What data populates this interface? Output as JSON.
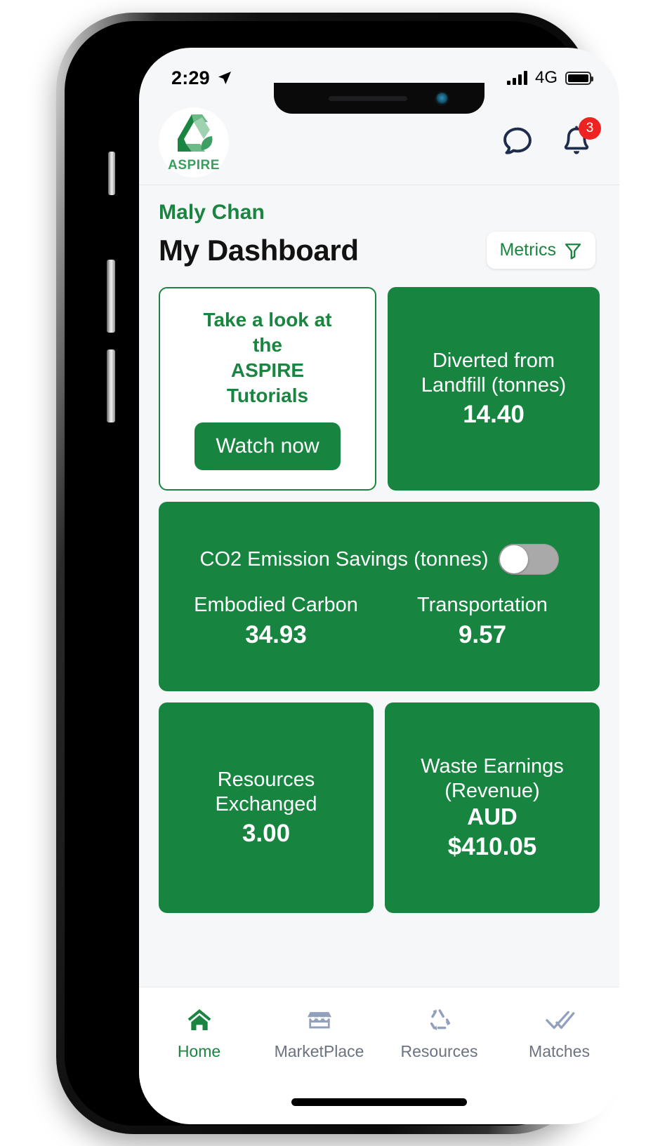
{
  "status_bar": {
    "time": "2:29",
    "location_icon": "location-arrow-icon",
    "network": "4G",
    "signal_icon": "signal-bars-icon",
    "battery_icon": "battery-full-icon"
  },
  "header": {
    "brand_name": "ASPIRE",
    "brand_logo_icon": "aspire-recycle-logo",
    "chat_icon": "chat-bubble-icon",
    "bell_icon": "notification-bell-icon",
    "notification_count": "3"
  },
  "dashboard": {
    "user_name": "Maly Chan",
    "title": "My Dashboard",
    "metrics_button": {
      "label": "Metrics",
      "icon": "filter-funnel-icon"
    }
  },
  "tutorial_card": {
    "line1": "Take a look at",
    "line2": "the",
    "line3": "ASPIRE",
    "line4": "Tutorials",
    "button_label": "Watch now"
  },
  "tiles": {
    "landfill": {
      "label_line1": "Diverted from",
      "label_line2": "Landfill (tonnes)",
      "value": "14.40"
    },
    "co2": {
      "title": "CO2 Emission Savings (tonnes)",
      "toggle_state": "off",
      "columns": [
        {
          "label": "Embodied Carbon",
          "value": "34.93"
        },
        {
          "label": "Transportation",
          "value": "9.57"
        }
      ]
    },
    "resources": {
      "label_line1": "Resources",
      "label_line2": "Exchanged",
      "value": "3.00"
    },
    "earnings": {
      "label_line1": "Waste Earnings",
      "label_line2": "(Revenue)",
      "currency": "AUD",
      "value": "$410.05"
    }
  },
  "tabbar": {
    "items": [
      {
        "label": "Home",
        "icon": "home-icon",
        "active": true
      },
      {
        "label": "MarketPlace",
        "icon": "storefront-icon",
        "active": false
      },
      {
        "label": "Resources",
        "icon": "recycle-icon",
        "active": false
      },
      {
        "label": "Matches",
        "icon": "double-check-icon",
        "active": false
      }
    ]
  },
  "colors": {
    "brand_green": "#1a8540",
    "tile_green": "#178540",
    "badge_red": "#ef2222",
    "navy": "#1f2d4d",
    "screen_bg": "#f5f7f8"
  }
}
